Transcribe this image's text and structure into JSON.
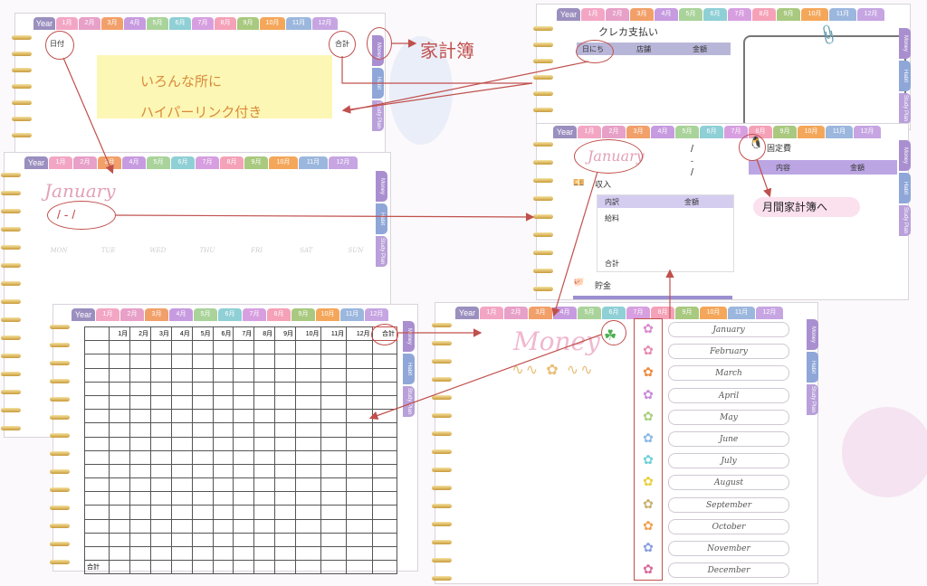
{
  "tabs": {
    "year": "Year",
    "months": [
      "1月",
      "2月",
      "3月",
      "4月",
      "5月",
      "6月",
      "7月",
      "8月",
      "9月",
      "10月",
      "11月",
      "12月"
    ]
  },
  "tab_colors": [
    "#f3a6c4",
    "#e7a0c8",
    "#f2a06a",
    "#c79be0",
    "#a9d39a",
    "#8fcfd6",
    "#d79fe0",
    "#f5a1b8",
    "#a8c97f",
    "#f4a75a",
    "#9cb7de",
    "#c6a5e2"
  ],
  "side_tabs": [
    "Money",
    "Habit",
    "Study Plan"
  ],
  "top_left": {
    "date_label": "日付",
    "total_label": "合計",
    "highlight_line1": "いろんな所に",
    "highlight_line2": "ハイパーリンク付き"
  },
  "annotations": {
    "kakeibo": "家計簿",
    "monthly_kakeibo": "月間家計簿へ"
  },
  "card_top_right": {
    "title": "クレカ支払い",
    "cols": [
      "日にち",
      "店舗",
      "金額"
    ]
  },
  "january_page": {
    "month": "January",
    "date_placeholder": "/ - /",
    "weekdays": [
      "MON",
      "TUE",
      "WED",
      "THU",
      "FRI",
      "SAT",
      "SUN"
    ]
  },
  "monthly_page": {
    "month": "January",
    "slash1": "/",
    "dash": "-",
    "slash2": "/",
    "fixed_cost": "固定費",
    "fixed_cols": [
      "内容",
      "金額"
    ],
    "income_label": "収入",
    "income_cols": [
      "内訳",
      "金額"
    ],
    "salary": "給料",
    "total": "合計",
    "savings": "貯金"
  },
  "table_page": {
    "months": [
      "1月",
      "2月",
      "3月",
      "4月",
      "5月",
      "6月",
      "7月",
      "8月",
      "9月",
      "10月",
      "11月",
      "12月"
    ],
    "total": "合計"
  },
  "money_index": {
    "title": "Money",
    "months": [
      "January",
      "February",
      "March",
      "April",
      "May",
      "June",
      "July",
      "August",
      "September",
      "October",
      "November",
      "December"
    ]
  },
  "icons": {
    "penguin": "penguin-icon",
    "paperclip": "paperclip-icon",
    "clover": "clover-icon"
  }
}
